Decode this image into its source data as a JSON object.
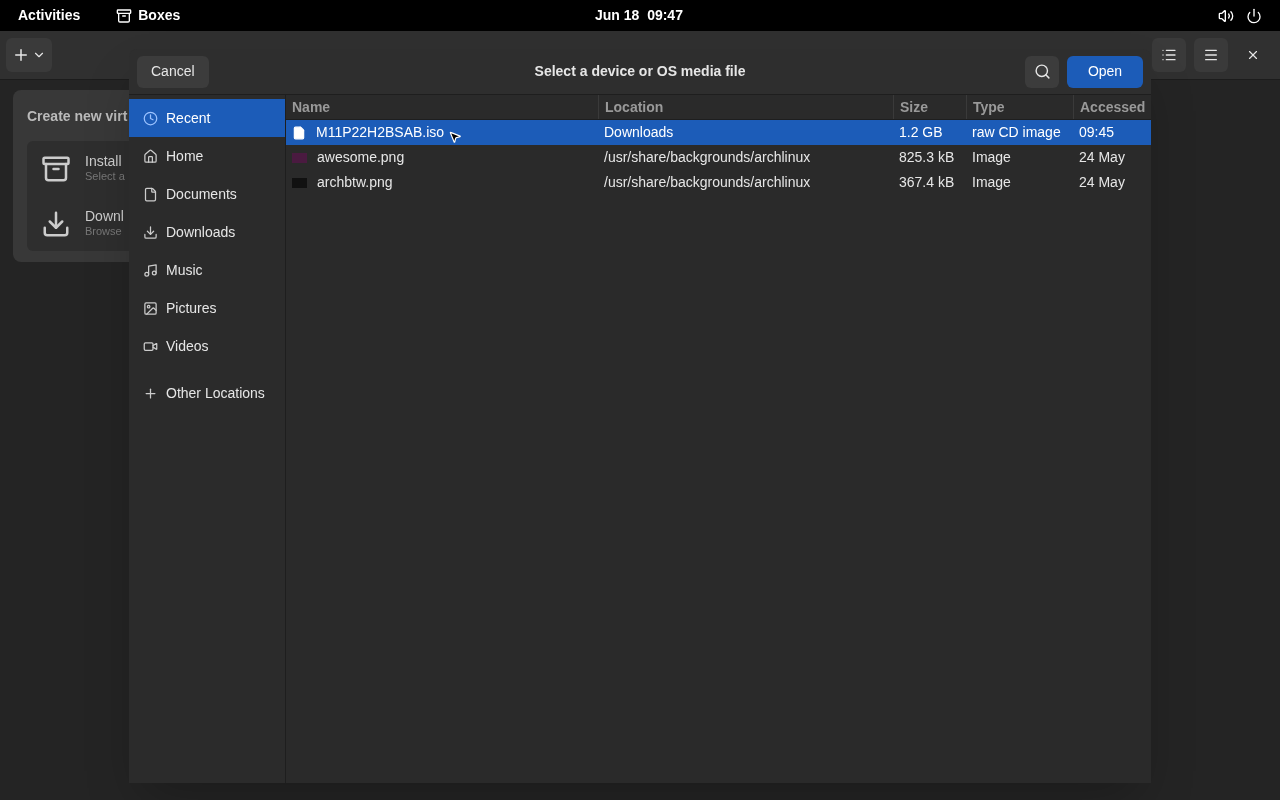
{
  "top_bar": {
    "activities": "Activities",
    "app": "Boxes",
    "clock": "Jun 18  09:47"
  },
  "popover": {
    "title": "Create new virt",
    "items": [
      {
        "kind": "install",
        "title": "Install",
        "subtitle": "Select a"
      },
      {
        "kind": "download",
        "title": "Downl",
        "subtitle": "Browse"
      }
    ]
  },
  "dialog": {
    "title": "Select a device or OS media file",
    "cancel": "Cancel",
    "open": "Open",
    "sidebar": [
      {
        "kind": "recent",
        "label": "Recent",
        "selected": true
      },
      {
        "kind": "home",
        "label": "Home",
        "selected": false
      },
      {
        "kind": "documents",
        "label": "Documents",
        "selected": false
      },
      {
        "kind": "downloads",
        "label": "Downloads",
        "selected": false
      },
      {
        "kind": "music",
        "label": "Music",
        "selected": false
      },
      {
        "kind": "pictures",
        "label": "Pictures",
        "selected": false
      },
      {
        "kind": "videos",
        "label": "Videos",
        "selected": false
      },
      {
        "kind": "other",
        "label": "Other Locations",
        "selected": false
      }
    ],
    "columns": [
      "Name",
      "Location",
      "Size",
      "Type",
      "Accessed"
    ],
    "rows": [
      {
        "kind": "file",
        "selected": true,
        "cells": [
          "M11P22H2BSAB.iso",
          "Downloads",
          "1.2 GB",
          "raw CD image",
          "09:45"
        ]
      },
      {
        "kind": "image",
        "color": "#4a1a40",
        "selected": false,
        "cells": [
          "awesome.png",
          "/usr/share/backgrounds/archlinux",
          "825.3 kB",
          "Image",
          "24 May"
        ]
      },
      {
        "kind": "image",
        "color": "#111111",
        "selected": false,
        "cells": [
          "archbtw.png",
          "/usr/share/backgrounds/archlinux",
          "367.4 kB",
          "Image",
          "24 May"
        ]
      }
    ]
  }
}
